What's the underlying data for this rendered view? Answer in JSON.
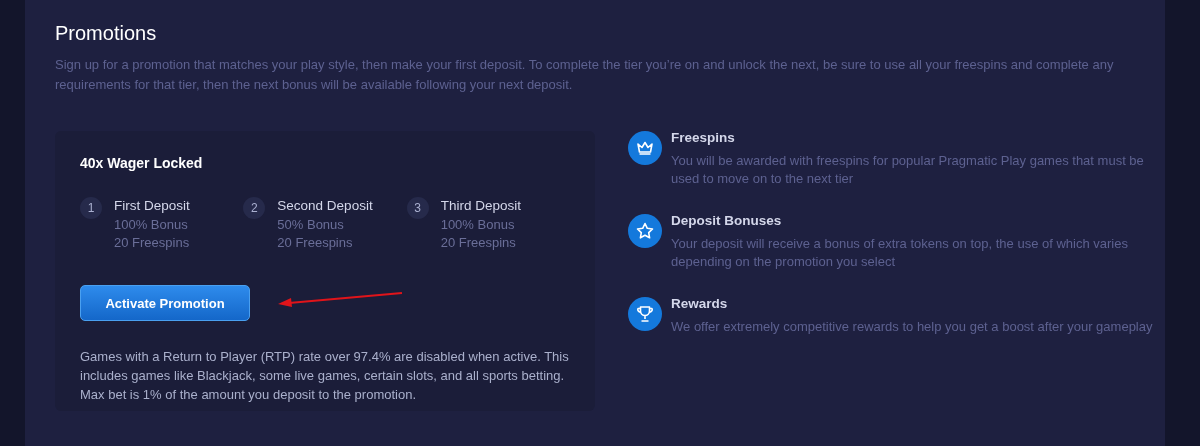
{
  "title": "Promotions",
  "description": "Sign up for a promotion that matches your play style, then make your first deposit. To complete the tier you’re on and unlock the next, be sure to use all your freespins and complete any requirements for that tier, then the next bonus will be available following your next deposit.",
  "promotion": {
    "title": "40x Wager Locked",
    "steps": [
      {
        "number": "1",
        "title": "First Deposit",
        "lines": [
          "100% Bonus",
          "20 Freespins"
        ]
      },
      {
        "number": "2",
        "title": "Second Deposit",
        "lines": [
          "50% Bonus",
          "20 Freespins"
        ]
      },
      {
        "number": "3",
        "title": "Third Deposit",
        "lines": [
          "100% Bonus",
          "20 Freespins"
        ]
      }
    ],
    "button": "Activate Promotion",
    "note": "Games with a Return to Player (RTP) rate over 97.4% are disabled when active. This includes games like Blackjack, some live games, certain slots, and all sports betting. Max bet is 1% of the amount you deposit to the promotion."
  },
  "features": [
    {
      "kind": "crown",
      "title": "Freespins",
      "text": "You will be awarded with freespins for popular Pragmatic Play games that must be used to move on to the next tier"
    },
    {
      "kind": "star",
      "title": "Deposit Bonuses",
      "text": "Your deposit will receive a bonus of extra tokens on top, the use of which varies depending on the promotion you select"
    },
    {
      "kind": "trophy",
      "title": "Rewards",
      "text": "We offer extremely competitive rewards to help you get a boost after your gameplay"
    }
  ]
}
